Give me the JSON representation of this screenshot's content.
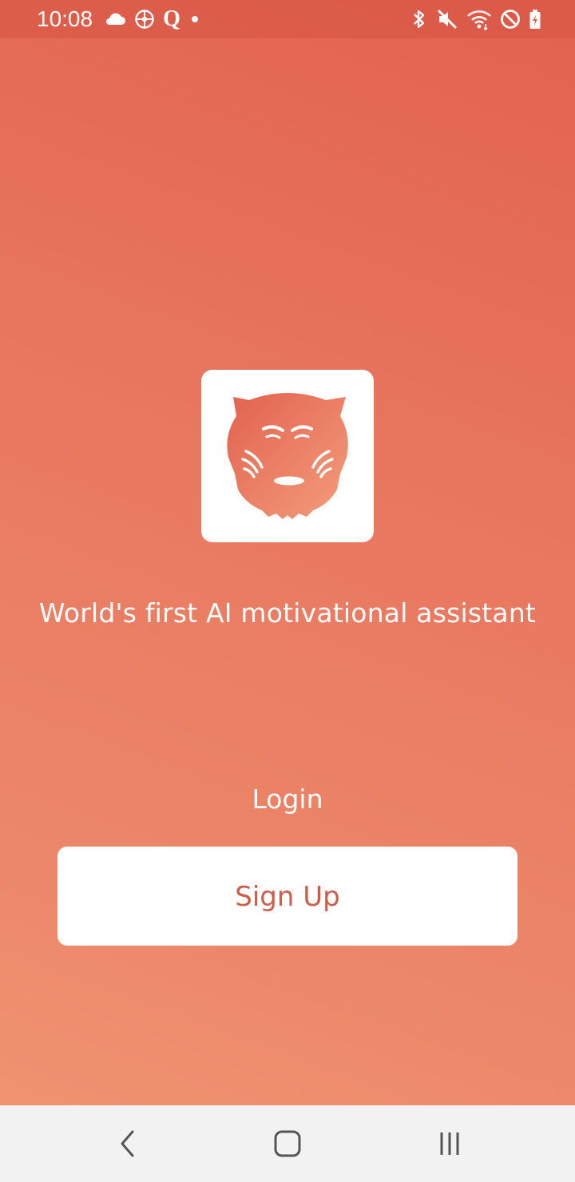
{
  "status_bar": {
    "time": "10:08",
    "left_icons": [
      "cloud-icon",
      "compass-icon",
      "q-app-icon",
      "dot-icon"
    ],
    "q_letter": "Q",
    "right_icons": [
      "bluetooth-icon",
      "mute-icon",
      "wifi-icon",
      "do-not-disturb-icon",
      "battery-charging-icon"
    ]
  },
  "logo": {
    "icon": "tiger-head-icon",
    "tile_color": "#ffffff",
    "gradient_from": "#e2624f",
    "gradient_to": "#f29a78"
  },
  "tagline": "World's first AI motivational assistant",
  "actions": {
    "login_label": "Login",
    "signup_label": "Sign Up"
  },
  "colors": {
    "background_top": "#e2624f",
    "background_bottom": "#f09672",
    "signup_text": "#cf5d4c",
    "nav_bar": "#f2f2f2"
  },
  "nav_bar": {
    "icons": [
      "back-icon",
      "home-icon",
      "recents-icon"
    ]
  }
}
